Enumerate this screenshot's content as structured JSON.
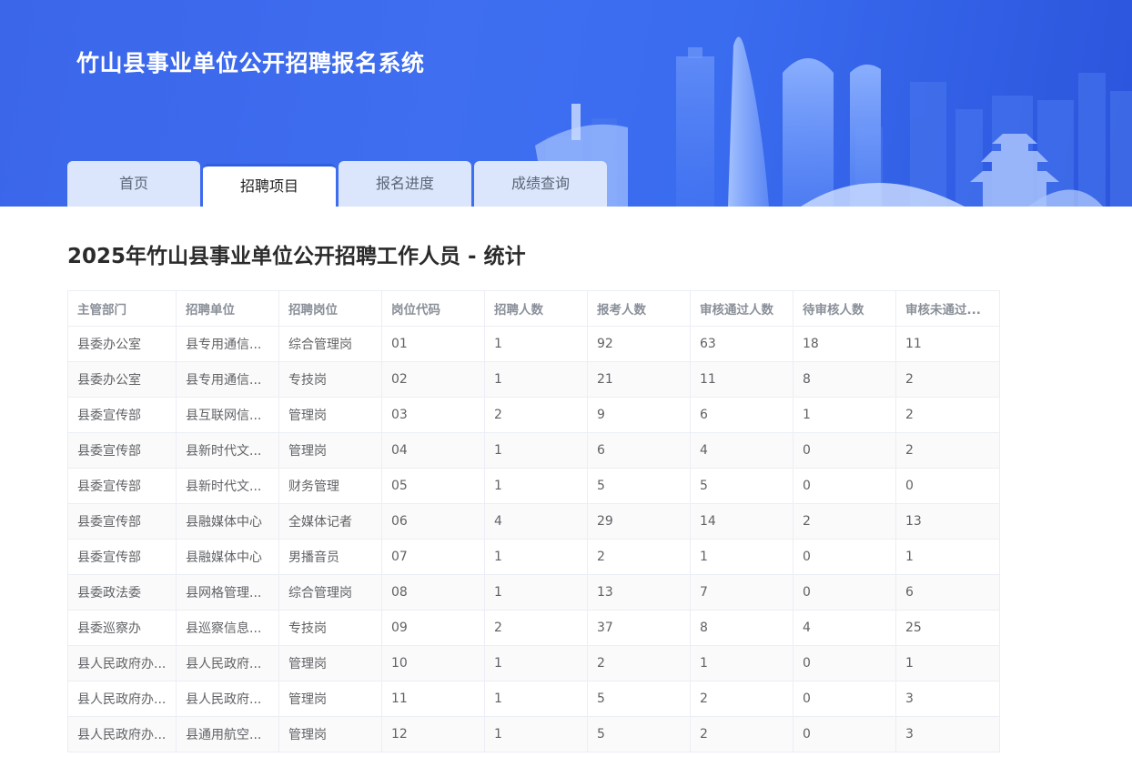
{
  "header": {
    "site_title": "竹山县事业单位公开招聘报名系统"
  },
  "nav": {
    "tabs": [
      {
        "label": "首页",
        "active": false
      },
      {
        "label": "招聘项目",
        "active": true
      },
      {
        "label": "报名进度",
        "active": false
      },
      {
        "label": "成绩查询",
        "active": false
      }
    ]
  },
  "main": {
    "page_title": "2025年竹山县事业单位公开招聘工作人员 - 统计",
    "table": {
      "headers": [
        "主管部门",
        "招聘单位",
        "招聘岗位",
        "岗位代码",
        "招聘人数",
        "报考人数",
        "审核通过人数",
        "待审核人数",
        "审核未通过..."
      ],
      "rows": [
        [
          "县委办公室",
          "县专用通信...",
          "综合管理岗",
          "01",
          "1",
          "92",
          "63",
          "18",
          "11"
        ],
        [
          "县委办公室",
          "县专用通信...",
          "专技岗",
          "02",
          "1",
          "21",
          "11",
          "8",
          "2"
        ],
        [
          "县委宣传部",
          "县互联网信...",
          "管理岗",
          "03",
          "2",
          "9",
          "6",
          "1",
          "2"
        ],
        [
          "县委宣传部",
          "县新时代文...",
          "管理岗",
          "04",
          "1",
          "6",
          "4",
          "0",
          "2"
        ],
        [
          "县委宣传部",
          "县新时代文...",
          "财务管理",
          "05",
          "1",
          "5",
          "5",
          "0",
          "0"
        ],
        [
          "县委宣传部",
          "县融媒体中心",
          "全媒体记者",
          "06",
          "4",
          "29",
          "14",
          "2",
          "13"
        ],
        [
          "县委宣传部",
          "县融媒体中心",
          "男播音员",
          "07",
          "1",
          "2",
          "1",
          "0",
          "1"
        ],
        [
          "县委政法委",
          "县网格管理...",
          "综合管理岗",
          "08",
          "1",
          "13",
          "7",
          "0",
          "6"
        ],
        [
          "县委巡察办",
          "县巡察信息...",
          "专技岗",
          "09",
          "2",
          "37",
          "8",
          "4",
          "25"
        ],
        [
          "县人民政府办...",
          "县人民政府...",
          "管理岗",
          "10",
          "1",
          "2",
          "1",
          "0",
          "1"
        ],
        [
          "县人民政府办...",
          "县人民政府...",
          "管理岗",
          "11",
          "1",
          "5",
          "2",
          "0",
          "3"
        ],
        [
          "县人民政府办...",
          "县通用航空...",
          "管理岗",
          "12",
          "1",
          "5",
          "2",
          "0",
          "3"
        ]
      ]
    }
  },
  "colors": {
    "banner_blue": "#3f6ef0",
    "tab_inactive_bg": "#dbe6fd",
    "tab_active_bg": "#ffffff",
    "table_border": "#ebeef5",
    "stripe_bg": "#fafafa"
  }
}
